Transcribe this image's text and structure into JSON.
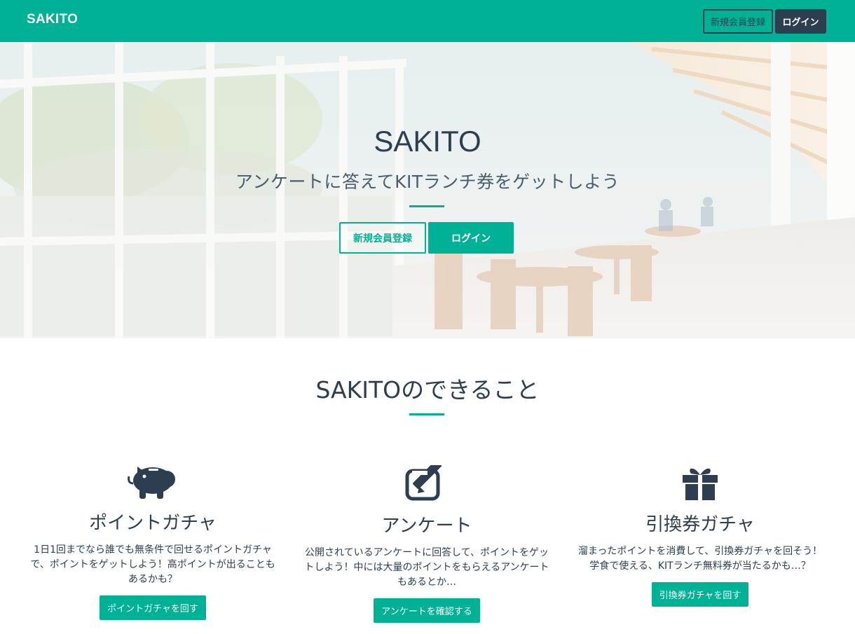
{
  "navbar": {
    "brand": "SAKITO",
    "register_label": "新規会員登録",
    "login_label": "ログイン"
  },
  "hero": {
    "title": "SAKITO",
    "subtitle": "アンケートに答えてKITランチ券をゲットしよう",
    "register_label": "新規会員登録",
    "login_label": "ログイン"
  },
  "features_section": {
    "title": "SAKITOのできること",
    "items": [
      {
        "icon": "piggy-bank-icon",
        "title": "ポイントガチャ",
        "description": "1日1回までなら誰でも無条件で回せるポイントガチャで、ポイントをゲットしよう！高ポイントが出ることもあるかも？",
        "button_label": "ポイントガチャを回す"
      },
      {
        "icon": "edit-pencil-icon",
        "title": "アンケート",
        "description": "公開されているアンケートに回答して、ポイントをゲットしよう！中には大量のポイントをもらえるアンケートもあるとか…",
        "button_label": "アンケートを確認する"
      },
      {
        "icon": "gift-icon",
        "title": "引換券ガチャ",
        "description": "溜まったポイントを消費して、引換券ガチャを回そう！学食で使える、KITランチ無料券が当たるかも…？",
        "button_label": "引換券ガチャを回す"
      }
    ]
  },
  "colors": {
    "accent": "#00b295",
    "dark": "#2c3e50"
  }
}
